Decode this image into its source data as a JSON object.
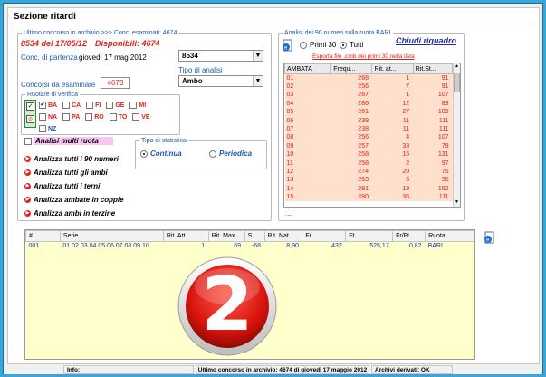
{
  "section_title": "Sezione ritardi",
  "last_draw": {
    "legend": "Ultimo concorso in archivio",
    "examined_label": ">>> Conc. esaminati: 4674",
    "draw_text": "8534 del 17/05/12",
    "available_text": "Disponibili: 4674",
    "start_label": "Conc. di partenza",
    "start_date": "giovedì 17 mag 2012",
    "start_select": "8534",
    "analysis_type_label": "Tipo di analisi",
    "analysis_type_value": "Ambo",
    "to_examine_label": "Concorsi da esaminare",
    "to_examine_value": "4673"
  },
  "wheels": {
    "legend": "Ruota/e di verifica",
    "row1": [
      {
        "label": "BA",
        "checked": true
      },
      {
        "label": "CA",
        "checked": false
      },
      {
        "label": "FI",
        "checked": false
      },
      {
        "label": "GE",
        "checked": false
      },
      {
        "label": "MI",
        "checked": false
      }
    ],
    "row2": [
      {
        "label": "NA",
        "checked": false
      },
      {
        "label": "PA",
        "checked": false
      },
      {
        "label": "RO",
        "checked": false
      },
      {
        "label": "TO",
        "checked": false
      },
      {
        "label": "VE",
        "checked": false
      }
    ],
    "row3": [
      {
        "label": "NZ",
        "checked": false
      }
    ]
  },
  "multi_wheel": "Analisi multi ruota",
  "stat_type": {
    "legend": "Tipo di statistica",
    "continua": "Continua",
    "periodica": "Periodica"
  },
  "actions": [
    "Analizza tutti i 90 numeri",
    "Analizza tutti gli ambi",
    "Analizza tutti i terni",
    "Analizza ambate in coppie",
    "Analizza ambi in terzine"
  ],
  "analysis_panel": {
    "legend": "Analisi dei 90 numeri sulla ruota BARI",
    "first30": "Primi 30",
    "all": "Tutti",
    "close_link": "Chiudi riquadro",
    "export_link": "Esporta file .cmb dei primi 30 nella lista",
    "columns": [
      "AMBATA",
      "Frequ...",
      "Rit. at...",
      "Rit.St..."
    ],
    "rows": [
      [
        "01",
        "268",
        "1",
        "91"
      ],
      [
        "02",
        "256",
        "7",
        "91"
      ],
      [
        "03",
        "267",
        "1",
        "107"
      ],
      [
        "04",
        "286",
        "12",
        "83"
      ],
      [
        "05",
        "261",
        "27",
        "109"
      ],
      [
        "06",
        "239",
        "11",
        "111"
      ],
      [
        "07",
        "238",
        "11",
        "111"
      ],
      [
        "08",
        "256",
        "4",
        "107"
      ],
      [
        "09",
        "257",
        "33",
        "79"
      ],
      [
        "10",
        "258",
        "16",
        "131"
      ],
      [
        "11",
        "258",
        "2",
        "97"
      ],
      [
        "12",
        "274",
        "20",
        "75"
      ],
      [
        "13",
        "253",
        "6",
        "96"
      ],
      [
        "14",
        "281",
        "19",
        "152"
      ],
      [
        "15",
        "280",
        "36",
        "111"
      ]
    ],
    "ellipsis": "..."
  },
  "results_table": {
    "columns": [
      "#",
      "Serie",
      "Rit. Att.",
      "Rit. Max",
      "S",
      "Rit. Nat",
      "Fr",
      "Ft",
      "Fr/Ft",
      "Ruota"
    ],
    "rows": [
      [
        "001",
        "01.02.03.04.05.06.07.08.09.10",
        "1",
        "69",
        "-68",
        "8,90",
        "432",
        "525,17",
        "0,82",
        "BARI"
      ]
    ]
  },
  "overlay_badge": "2",
  "status_bar": {
    "info": "Info:",
    "archive": "Ultimo concorso in archivio: 4674 di giovedì 17 maggio 2012",
    "derived": "Archivi derivati: OK"
  },
  "colors": {
    "accent_red": "#e4201a",
    "link_blue": "#1e5aa8",
    "list_bg": "#ffe0cc",
    "results_bg": "#ffffcc",
    "window_border": "#3aa6d6"
  }
}
